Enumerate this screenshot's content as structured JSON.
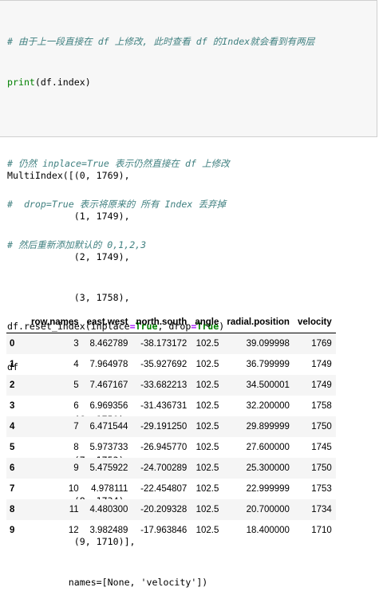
{
  "code": {
    "line1": "# 由于上一段直接在 df 上修改, 此时查看 df 的Index就会看到有两层",
    "line2_fn": "print",
    "line2_rest": "(df.index)",
    "line3": "# 仍然 inplace=True 表示仍然直接在 df 上修改",
    "line4": "#  drop=True 表示将原来的 所有 Index 丢弃掉",
    "line5": "# 然后重新添加默认的 0,1,2,3",
    "line6_a": "df.reset_index(inplace",
    "line6_eq1": "=",
    "line6_true1": "True",
    "line6_b": ", drop",
    "line6_eq2": "=",
    "line6_true2": "True",
    "line6_c": ")",
    "line7": "df"
  },
  "output": {
    "lines": [
      "MultiIndex([(0, 1769),",
      "            (1, 1749),",
      "            (2, 1749),",
      "            (3, 1758),",
      "            (4, 1750),",
      "            (5, 1745),",
      "            (6, 1750),",
      "            (7, 1753),",
      "            (8, 1734),",
      "            (9, 1710)],",
      "           names=[None, 'velocity'])"
    ]
  },
  "table": {
    "columns": [
      "",
      "row.names",
      "east.west",
      "north.south",
      "angle",
      "radial.position",
      "velocity"
    ],
    "rows": [
      [
        "0",
        "3",
        "8.462789",
        "-38.173172",
        "102.5",
        "39.099998",
        "1769"
      ],
      [
        "1",
        "4",
        "7.964978",
        "-35.927692",
        "102.5",
        "36.799999",
        "1749"
      ],
      [
        "2",
        "5",
        "7.467167",
        "-33.682213",
        "102.5",
        "34.500001",
        "1749"
      ],
      [
        "3",
        "6",
        "6.969356",
        "-31.436731",
        "102.5",
        "32.200000",
        "1758"
      ],
      [
        "4",
        "7",
        "6.471544",
        "-29.191250",
        "102.5",
        "29.899999",
        "1750"
      ],
      [
        "5",
        "8",
        "5.973733",
        "-26.945770",
        "102.5",
        "27.600000",
        "1745"
      ],
      [
        "6",
        "9",
        "5.475922",
        "-24.700289",
        "102.5",
        "25.300000",
        "1750"
      ],
      [
        "7",
        "10",
        "4.978111",
        "-22.454807",
        "102.5",
        "22.999999",
        "1753"
      ],
      [
        "8",
        "11",
        "4.480300",
        "-20.209328",
        "102.5",
        "20.700000",
        "1734"
      ],
      [
        "9",
        "12",
        "3.982489",
        "-17.963846",
        "102.5",
        "18.400000",
        "1710"
      ]
    ]
  }
}
